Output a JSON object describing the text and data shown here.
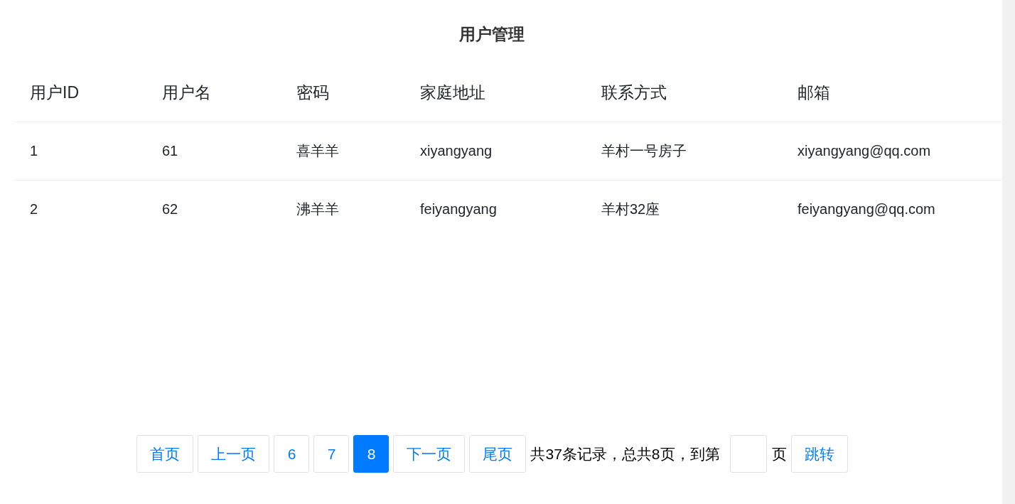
{
  "title": "用户管理",
  "table": {
    "columns": [
      "用户ID",
      "用户名",
      "密码",
      "家庭地址",
      "联系方式",
      "邮箱"
    ],
    "rows": [
      [
        "1",
        "61",
        "喜羊羊",
        "xiyangyang",
        "羊村一号房子",
        "xiyangyang@qq.com"
      ],
      [
        "2",
        "62",
        "沸羊羊",
        "feiyangyang",
        "羊村32座",
        "feiyangyang@qq.com"
      ]
    ]
  },
  "pagination": {
    "items": [
      {
        "label": "首页",
        "kind": "nav",
        "selected": false
      },
      {
        "label": "上一页",
        "kind": "nav",
        "selected": false
      },
      {
        "label": "6",
        "kind": "page",
        "selected": false
      },
      {
        "label": "7",
        "kind": "page",
        "selected": false
      },
      {
        "label": "8",
        "kind": "page",
        "selected": true
      },
      {
        "label": "下一页",
        "kind": "nav",
        "selected": false
      },
      {
        "label": "尾页",
        "kind": "nav",
        "selected": false
      }
    ],
    "summary": "共37条记录，总共8页，到第",
    "suffix": "页",
    "jump_button": "跳转"
  }
}
